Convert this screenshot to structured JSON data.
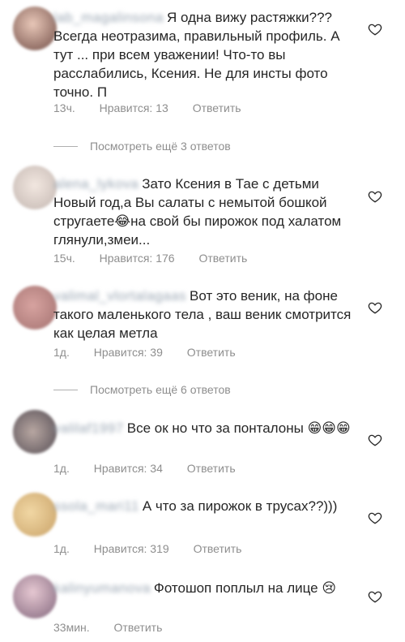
{
  "comments": [
    {
      "username": "lab_magalinsona",
      "text": "Я одна вижу растяжки??? Всегда неотразима, правильный профиль. А тут ... при всем уважении! Что-то вы расслабились, Ксения. Не для инсты фото точно. П",
      "time": "13ч.",
      "likes": "Нравится: 13",
      "reply": "Ответить"
    },
    {
      "username": "alena_lykova",
      "text": "Зато Ксения в Тае с детьми Новый год,а Вы салаты с немытой бошкой стругаете😂на свой бы пирожок под халатом глянули,змеи...",
      "time": "15ч.",
      "likes": "Нравится: 176",
      "reply": "Ответить"
    },
    {
      "username": "valimal_vlortalagaas",
      "text": "Вот это веник, на фоне такого маленького тела , ваш веник смотрится как целая метла",
      "time": "1д.",
      "likes": "Нравится: 39",
      "reply": "Ответить"
    },
    {
      "username": "valilaf1997",
      "text": "Все ок но что за понталоны 😁😁😁",
      "time": "1д.",
      "likes": "Нравится: 34",
      "reply": "Ответить"
    },
    {
      "username": "ssola_mari11",
      "text": "А что за пирожок в трусах??)))",
      "time": "1д.",
      "likes": "Нравится: 319",
      "reply": "Ответить"
    },
    {
      "username": "kalinyumanova",
      "text": "Фотошоп поплыл на лице 😢",
      "time": "33мин.",
      "reply": "Ответить"
    }
  ],
  "more_replies": [
    "Посмотреть ещё 3 ответов",
    "Посмотреть ещё 6 ответов"
  ],
  "colors": {
    "text": "#262626",
    "meta": "#8e8e8e"
  },
  "icons": {
    "like": "heart-outline-icon"
  }
}
